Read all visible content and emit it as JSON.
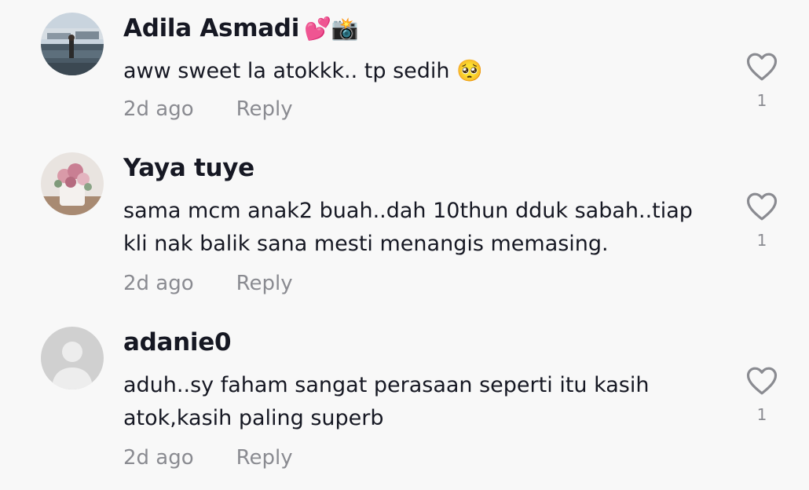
{
  "comments": [
    {
      "username": "Adila Asmadi",
      "username_emoji": "💕📸",
      "lines": [
        "aww sweet la atokkk.. tp sedih 🥺"
      ],
      "time": "2d ago",
      "reply_label": "Reply",
      "likes": "1",
      "avatar": "photo-harbor"
    },
    {
      "username": "Yaya tuye",
      "username_emoji": "",
      "lines": [
        "sama mcm anak2 buah..dah 10thun dduk sabah..tiap",
        "kli nak balik sana mesti menangis memasing."
      ],
      "time": "2d ago",
      "reply_label": "Reply",
      "likes": "1",
      "avatar": "photo-flowers"
    },
    {
      "username": "adanie0",
      "username_emoji": "",
      "lines": [
        "aduh..sy faham sangat perasaan seperti itu kasih",
        "atok,kasih paling superb"
      ],
      "time": "2d ago",
      "reply_label": "Reply",
      "likes": "1",
      "avatar": "default-avatar"
    }
  ],
  "colors": {
    "background": "#f8f8f8",
    "text_primary": "#161823",
    "text_secondary": "#8a8b91",
    "heart_outline": "#8a8b91"
  }
}
